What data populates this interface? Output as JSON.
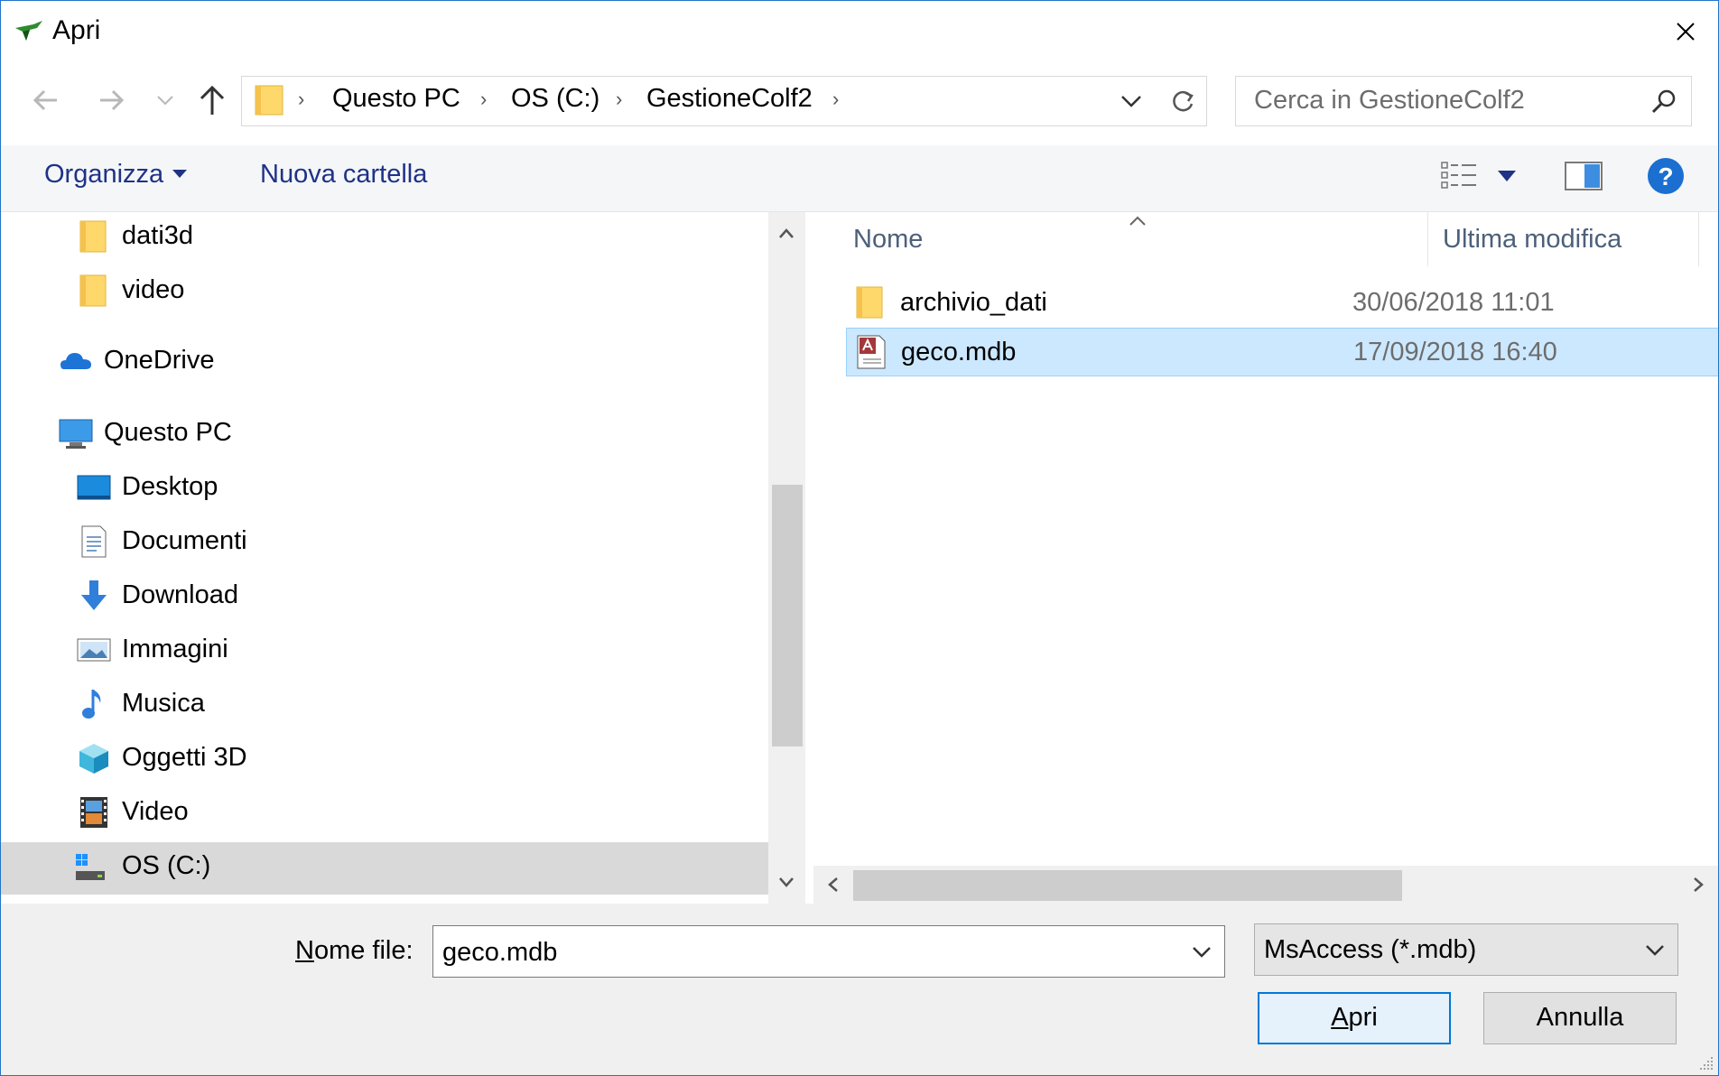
{
  "window": {
    "title": "Apri"
  },
  "address": {
    "crumbs": [
      "Questo PC",
      "OS (C:)",
      "GestioneColf2"
    ]
  },
  "search": {
    "placeholder": "Cerca in GestioneColf2"
  },
  "toolbar": {
    "organize_label": "Organizza",
    "new_folder_label": "Nuova cartella"
  },
  "nav": {
    "items": [
      {
        "label": "dati3d",
        "icon": "folder-icon"
      },
      {
        "label": "video",
        "icon": "folder-icon"
      },
      {
        "label": "OneDrive",
        "icon": "onedrive-icon"
      },
      {
        "label": "Questo PC",
        "icon": "computer-icon"
      },
      {
        "label": "Desktop",
        "icon": "desktop-icon"
      },
      {
        "label": "Documenti",
        "icon": "documents-icon"
      },
      {
        "label": "Download",
        "icon": "download-icon"
      },
      {
        "label": "Immagini",
        "icon": "pictures-icon"
      },
      {
        "label": "Musica",
        "icon": "music-icon"
      },
      {
        "label": "Oggetti 3D",
        "icon": "objects-3d-icon"
      },
      {
        "label": "Video",
        "icon": "video-icon"
      },
      {
        "label": "OS (C:)",
        "icon": "drive-icon"
      }
    ],
    "selected": "OS (C:)"
  },
  "filelist": {
    "columns": [
      "Nome",
      "Ultima modifica"
    ],
    "rows": [
      {
        "name": "archivio_dati",
        "modified": "30/06/2018 11:01",
        "icon": "folder-icon"
      },
      {
        "name": "geco.mdb",
        "modified": "17/09/2018 16:40",
        "icon": "access-db-icon",
        "selected": true
      }
    ]
  },
  "bottom": {
    "filename_label_u": "N",
    "filename_label_rest": "ome file:",
    "filename_value": "geco.mdb",
    "filter_value": "MsAccess (*.mdb)",
    "open_u": "A",
    "open_rest": "pri",
    "cancel_label": "Annulla"
  },
  "colors": {
    "accent": "#0078d7",
    "selection": "#cce8ff",
    "link_text": "#1e3287",
    "help": "#1a6fd1"
  }
}
